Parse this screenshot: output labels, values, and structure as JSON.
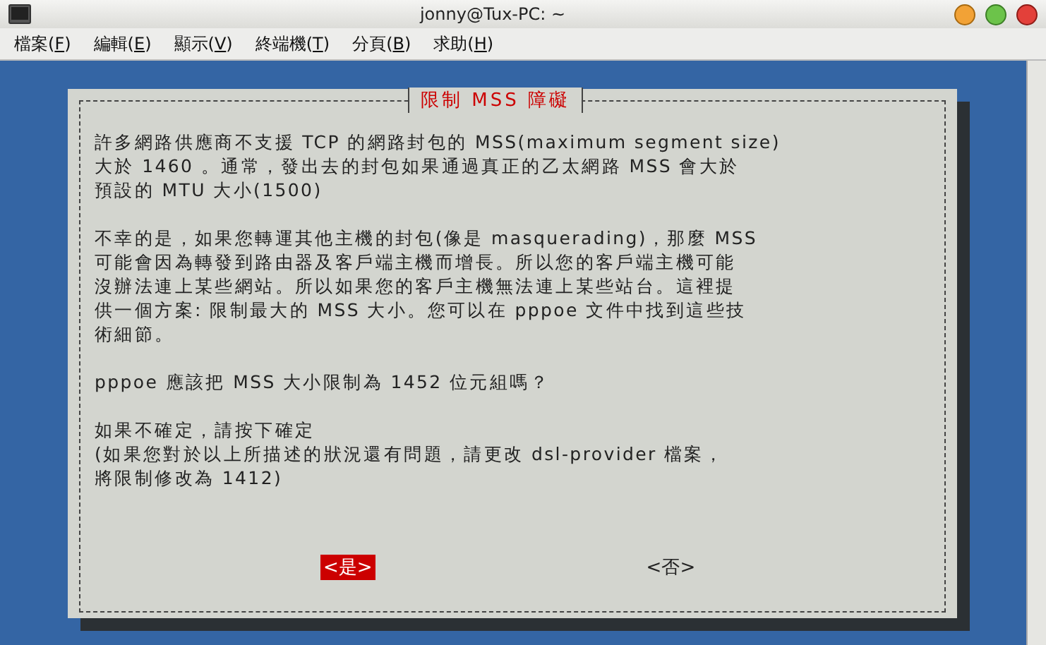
{
  "window": {
    "title": "jonny@Tux-PC: ~"
  },
  "menu": [
    {
      "before": "檔案(",
      "mnemonic": "F",
      "after": ")"
    },
    {
      "before": "編輯(",
      "mnemonic": "E",
      "after": ")"
    },
    {
      "before": "顯示(",
      "mnemonic": "V",
      "after": ")"
    },
    {
      "before": "終端機(",
      "mnemonic": "T",
      "after": ")"
    },
    {
      "before": "分頁(",
      "mnemonic": "B",
      "after": ")"
    },
    {
      "before": "求助(",
      "mnemonic": "H",
      "after": ")"
    }
  ],
  "dialog": {
    "title": "限制 MSS 障礙",
    "paragraphs": [
      [
        "許多網路供應商不支援 TCP 的網路封包的 MSS(maximum segment size)",
        "大於 1460 。通常，發出去的封包如果通過真正的乙太網路 MSS 會大於",
        "預設的 MTU 大小(1500)"
      ],
      [
        "不幸的是，如果您轉運其他主機的封包(像是 masquerading)，那麼 MSS",
        "可能會因為轉發到路由器及客戶端主機而增長。所以您的客戶端主機可能",
        "沒辦法連上某些網站。所以如果您的客戶主機無法連上某些站台。這裡提",
        "供一個方案: 限制最大的 MSS 大小。您可以在 pppoe 文件中找到這些技",
        "術細節。"
      ],
      [
        "pppoe 應該把 MSS 大小限制為 1452 位元組嗎？"
      ],
      [
        "如果不確定，請按下確定",
        "(如果您對於以上所描述的狀況還有問題，請更改 dsl-provider 檔案，",
        "將限制修改為 1412)"
      ]
    ],
    "buttons": [
      {
        "label": "<是>",
        "selected": true
      },
      {
        "label": "<否>",
        "selected": false
      }
    ]
  }
}
